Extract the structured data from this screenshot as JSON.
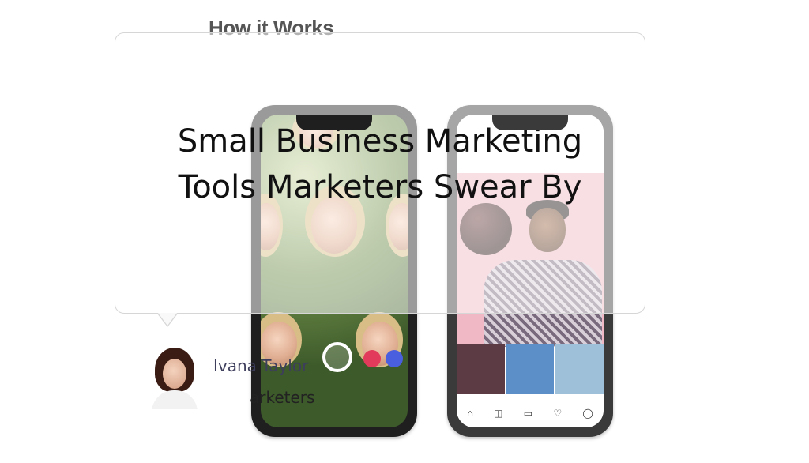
{
  "background_image": {
    "heading": "How it Works"
  },
  "testimonial": {
    "quote": {
      "line1": "Small Business Marketing",
      "line2": "Tools Marketers Swear By"
    },
    "author": {
      "name": "Ivana Taylor",
      "role_fragment": "arketers"
    }
  },
  "colors": {
    "title_text": "#111111",
    "author_name": "#3d3d5c",
    "bubble_border": "#d6d6d6"
  }
}
